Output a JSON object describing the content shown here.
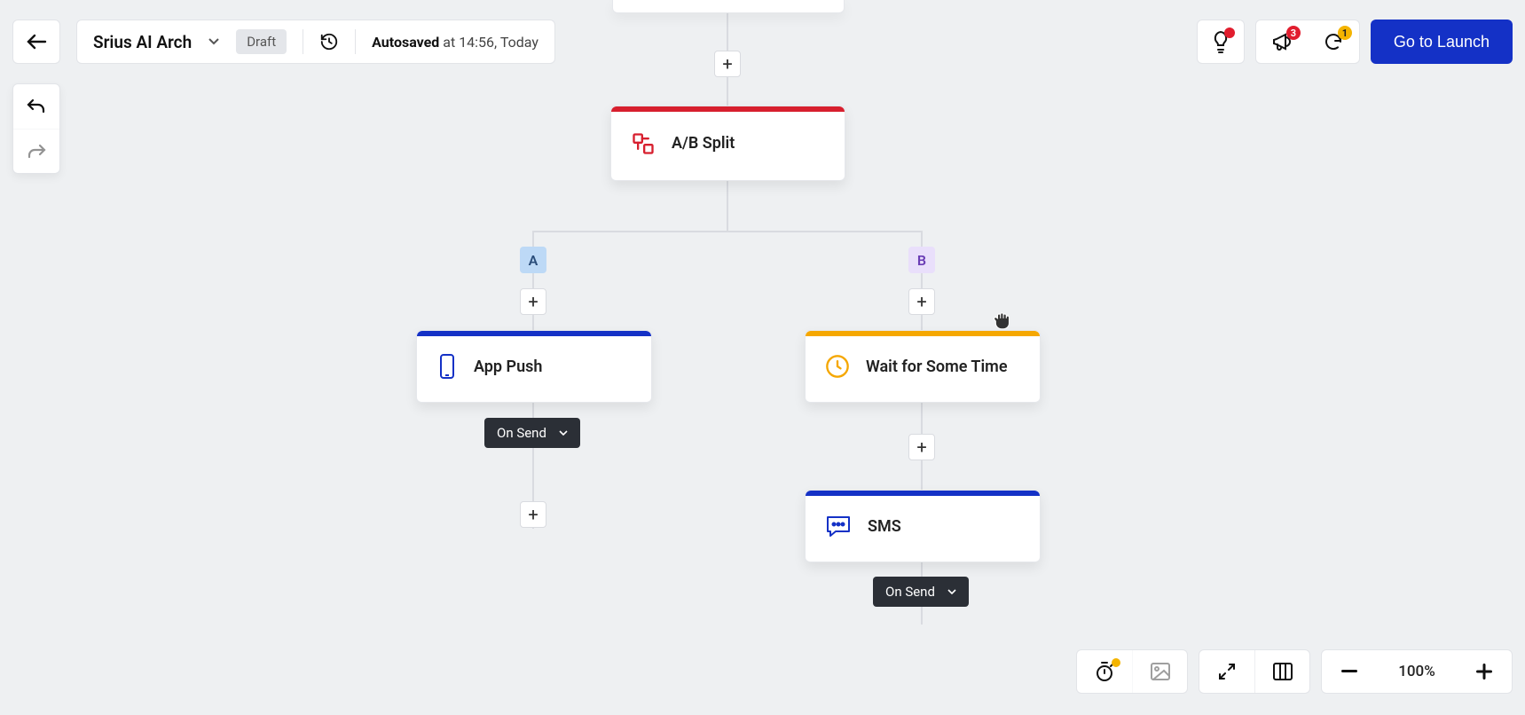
{
  "header": {
    "title": "Srius AI Arch",
    "status_badge": "Draft",
    "autosave_prefix": "Autosaved",
    "autosave_rest": " at 14:56, Today",
    "launch_label": "Go to Launch",
    "notif_count": "3",
    "refresh_count": "1"
  },
  "nodes": {
    "ab_split": "A/B Split",
    "app_push": "App Push",
    "wait": "Wait for Some Time",
    "sms": "SMS"
  },
  "branches": {
    "a": "A",
    "b": "B"
  },
  "pills": {
    "on_send_a": "On Send",
    "on_send_b": "On Send"
  },
  "zoom": {
    "level": "100%"
  }
}
